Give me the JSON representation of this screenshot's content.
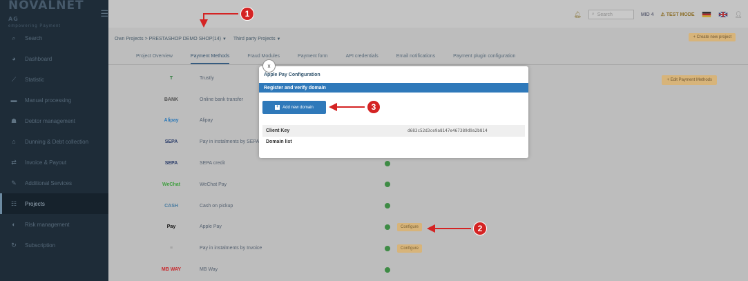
{
  "sidebar": {
    "logo": "NOVALNET",
    "logo_suffix": "AG",
    "tagline": "empowering Payment",
    "items": [
      {
        "label": "Search",
        "icon": "search-icon",
        "glyph": "⌕"
      },
      {
        "label": "Dashboard",
        "icon": "dashboard-icon",
        "glyph": "◕"
      },
      {
        "label": "Statistic",
        "icon": "chart-icon",
        "glyph": "⟋"
      },
      {
        "label": "Manual processing",
        "icon": "keyboard-icon",
        "glyph": "▬"
      },
      {
        "label": "Debtor management",
        "icon": "users-icon",
        "glyph": "☗"
      },
      {
        "label": "Dunning & Debt collection",
        "icon": "bank-icon",
        "glyph": "⌂"
      },
      {
        "label": "Invoice & Payout",
        "icon": "exchange-icon",
        "glyph": "⇄"
      },
      {
        "label": "Additional Services",
        "icon": "wrench-icon",
        "glyph": "✎"
      },
      {
        "label": "Projects",
        "icon": "sitemap-icon",
        "glyph": "☷"
      },
      {
        "label": "Risk management",
        "icon": "shield-icon",
        "glyph": "◐"
      },
      {
        "label": "Subscription",
        "icon": "refresh-icon",
        "glyph": "↻"
      }
    ]
  },
  "topbar": {
    "search_placeholder": "Search",
    "mid_label": "MID 4",
    "test_mode": "TEST MODE"
  },
  "breadcrumb": {
    "own_projects": "Own Projects > PRESTASHOP DEMO SHOP(14)",
    "third_party": "Third party Projects"
  },
  "create_project": "+ Create new project",
  "tabs": [
    "Project Overview",
    "Payment Methods",
    "Fraud Modules",
    "Payment form",
    "API credentials",
    "Email notifications",
    "Payment plugin configuration"
  ],
  "active_tab": 1,
  "edit_payment_methods": "+ Edit Payment Methods",
  "payment_methods": [
    {
      "name": "Trustly",
      "logo": "T",
      "logo_color": "#2f7c3c",
      "active": false,
      "configure": false
    },
    {
      "name": "Online bank transfer",
      "logo": "BANK",
      "logo_color": "#505050",
      "active": false,
      "configure": false
    },
    {
      "name": "Alipay",
      "logo": "Alipay",
      "logo_color": "#2f7ab8",
      "active": false,
      "configure": false
    },
    {
      "name": "Pay in instalments by SEPA",
      "logo": "SEPA",
      "logo_color": "#2b3d6a",
      "active": false,
      "configure": false
    },
    {
      "name": "SEPA credit",
      "logo": "SEPA",
      "logo_color": "#2b3d6a",
      "active": true,
      "configure": false
    },
    {
      "name": "WeChat Pay",
      "logo": "WeChat",
      "logo_color": "#3e9e3e",
      "active": true,
      "configure": false
    },
    {
      "name": "Cash on pickup",
      "logo": "CASH",
      "logo_color": "#4a7ca0",
      "active": true,
      "configure": false
    },
    {
      "name": "Apple Pay",
      "logo": "Pay",
      "logo_color": "#111111",
      "active": true,
      "configure": true
    },
    {
      "name": "Pay in instalments by Invoice",
      "logo": "≡",
      "logo_color": "#909090",
      "active": true,
      "configure": true
    },
    {
      "name": "MB Way",
      "logo": "MB WAY",
      "logo_color": "#c7262a",
      "active": true,
      "configure": false
    }
  ],
  "configure_label": "Configure",
  "modal": {
    "title": "Apple Pay Configuration",
    "section": "Register and verify domain",
    "add_button": "Add new domain",
    "client_key_label": "Client Key",
    "client_key_value": "d683c52d3ce9a8147e467389d9a2b814",
    "domain_list_label": "Domain list",
    "close": "x"
  },
  "callouts": [
    "1",
    "2",
    "3"
  ],
  "colors": {
    "accent": "#2f79ba",
    "callout": "#d42323",
    "sidebar": "#1e2c38",
    "gold": "#d7b47a"
  }
}
